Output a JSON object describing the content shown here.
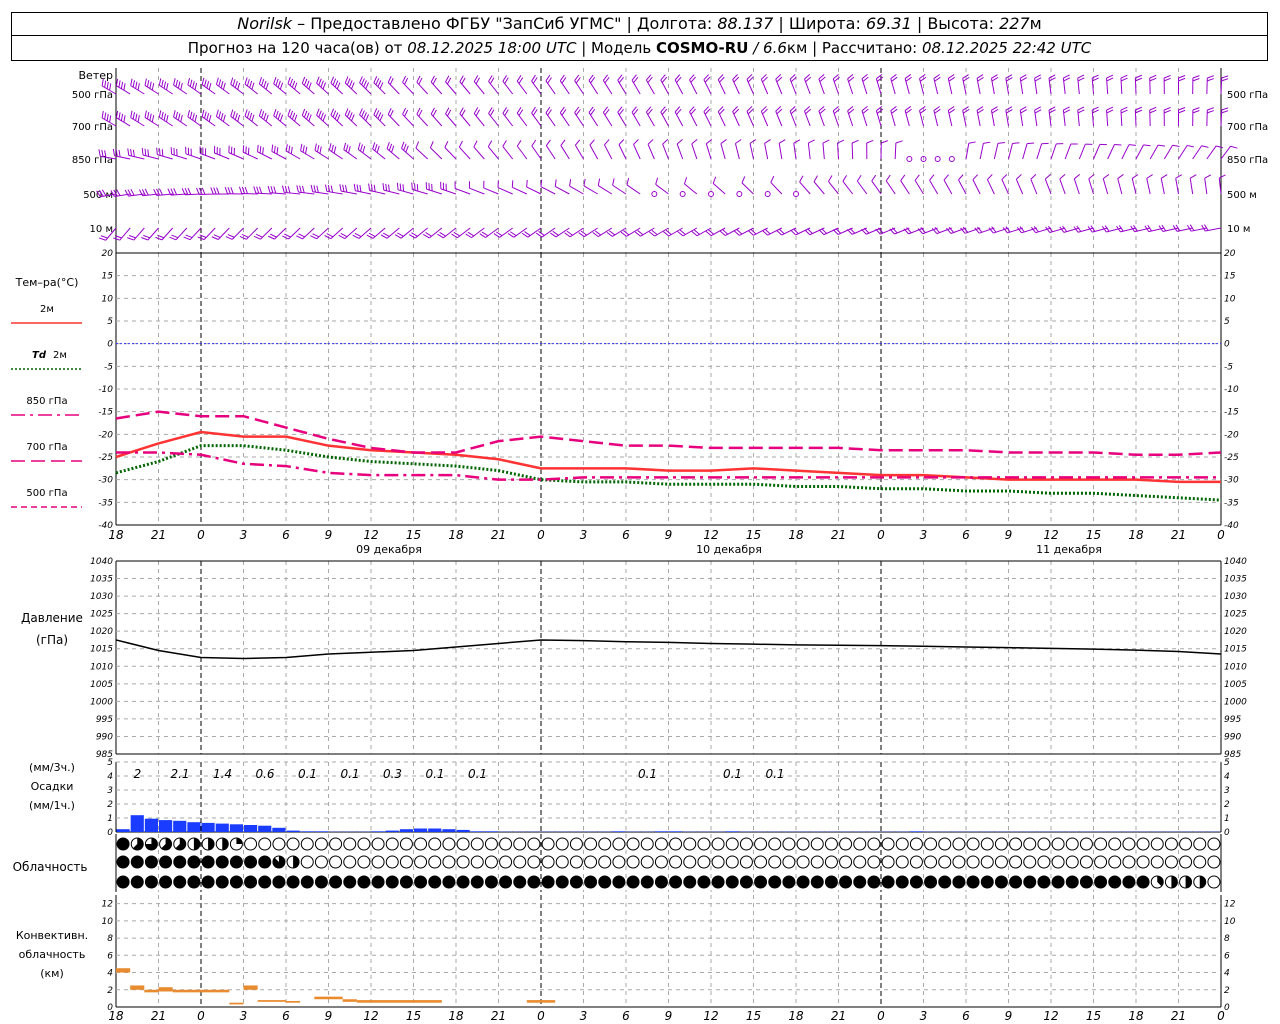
{
  "header": {
    "station": "Norilsk",
    "dash": " – ",
    "provider": "Предоставлено ФГБУ \"ЗапСиб УГМС\"",
    "sep": " | ",
    "lon_label": "Долгота: ",
    "lon_value": "88.137",
    "lat_label": "Широта: ",
    "lat_value": "69.31",
    "alt_label": "Высота: ",
    "alt_value": "227",
    "alt_unit": "м",
    "forecast_prefix": "Прогноз на 120 часа(ов) от ",
    "forecast_start": "08.12.2025 18:00 UTC",
    "model_label": "  | Модель ",
    "model_name": "COSMO-RU",
    "model_res": " / 6.6",
    "model_unit": "км",
    "computed_label": " | Рассчитано: ",
    "computed_time": "08.12.2025 22:42 UTC"
  },
  "colors": {
    "wind": "#9900cc",
    "t2m": "#ff3333",
    "td2m": "#006600",
    "t850": "#e6007e",
    "zero_line": "#3333ff",
    "pressure": "#000000",
    "precip": "#1a3cff",
    "conv": "#e88a2e",
    "grid": "#aaaaaa"
  },
  "wind_panel": {
    "title": "Ветер",
    "levels": [
      "500 гПа",
      "700 гПа",
      "850 гПа",
      "500  м",
      "10   м"
    ]
  },
  "temp_panel": {
    "title": "Тем–ра(°С)",
    "yticks": [
      20,
      15,
      10,
      5,
      0,
      -5,
      -10,
      -15,
      -20,
      -25,
      -30,
      -35,
      -40
    ],
    "legend": [
      {
        "label": "2м",
        "style": "solid",
        "color": "#ff3333"
      },
      {
        "label_a": "Td",
        "label_b": "2м",
        "style": "dotted",
        "color": "#006600"
      },
      {
        "label": "850 гПа",
        "style": "dash-dot",
        "color": "#e6007e"
      },
      {
        "label": "700 гПа",
        "style": "long-dash",
        "color": "#e6007e"
      },
      {
        "label": "500 гПа",
        "style": "short-dash",
        "color": "#e6007e"
      }
    ]
  },
  "x_axis": {
    "hour_labels": [
      "18",
      "21",
      "0",
      "3",
      "6",
      "9",
      "12",
      "15",
      "18",
      "21",
      "0",
      "3",
      "6",
      "9",
      "12",
      "15",
      "18",
      "21",
      "0",
      "3",
      "6",
      "9",
      "12",
      "15",
      "18",
      "21",
      "0"
    ],
    "dates": [
      "09 декабря",
      "10 декабря",
      "11 декабря"
    ]
  },
  "pressure_panel": {
    "title_a": "Давление",
    "title_b": "(гПа)",
    "yticks": [
      1040,
      1035,
      1030,
      1025,
      1020,
      1015,
      1010,
      1005,
      1000,
      995,
      990,
      985
    ]
  },
  "precip_panel": {
    "label_a": "(мм/3ч.)",
    "label_b": "Осадки",
    "label_c": "(мм/1ч.)",
    "yticks": [
      5,
      4,
      3,
      2,
      1,
      0
    ],
    "totals_3h": [
      {
        "h": 3,
        "v": "2"
      },
      {
        "h": 6,
        "v": "2.1"
      },
      {
        "h": 9,
        "v": "1.4"
      },
      {
        "h": 12,
        "v": "0.6"
      },
      {
        "h": 15,
        "v": "0.1"
      },
      {
        "h": 18,
        "v": "0.1"
      },
      {
        "h": 21,
        "v": "0.3"
      },
      {
        "h": 24,
        "v": "0.1"
      },
      {
        "h": 27,
        "v": "0.1"
      },
      {
        "h": 39,
        "v": "0.1"
      },
      {
        "h": 45,
        "v": "0.1"
      },
      {
        "h": 48,
        "v": "0.1"
      }
    ]
  },
  "cloud_panel": {
    "title": "Облачность"
  },
  "conv_panel": {
    "label_a": "Конвективн.",
    "label_b": "облачность",
    "label_c": "(км)",
    "yticks": [
      12,
      10,
      8,
      6,
      4,
      2,
      0
    ]
  },
  "chart_data": {
    "type": "line",
    "x_hours_from_start": [
      0,
      3,
      6,
      9,
      12,
      15,
      18,
      21,
      24,
      27,
      30,
      33,
      36,
      39,
      42,
      45,
      48,
      51,
      54,
      57,
      60,
      63,
      66,
      69,
      72,
      75,
      78
    ],
    "x_unit": "hours since 08.12.2025 18:00 UTC",
    "temperature": {
      "ylim": [
        -40,
        20
      ],
      "series": [
        {
          "name": "2м",
          "values": [
            -25,
            -22,
            -19.5,
            -20.5,
            -20.5,
            -22.5,
            -23.5,
            -24,
            -24.5,
            -25.5,
            -27.5,
            -27.5,
            -27.5,
            -28,
            -28,
            -27.5,
            -28,
            -28.5,
            -29,
            -29,
            -29.5,
            -30,
            -30,
            -30,
            -30,
            -30.5,
            -30.5
          ]
        },
        {
          "name": "Td 2м",
          "values": [
            -28.5,
            -26,
            -22.5,
            -22.5,
            -23.5,
            -25,
            -26,
            -26.5,
            -27,
            -28,
            -30,
            -30.5,
            -30.5,
            -31,
            -31,
            -31,
            -31.5,
            -31.5,
            -32,
            -32,
            -32.5,
            -32.5,
            -33,
            -33,
            -33.5,
            -34,
            -34.5
          ]
        },
        {
          "name": "850 гПа",
          "values": [
            -24,
            -24,
            -24.5,
            -26.5,
            -27,
            -28.5,
            -29,
            -29,
            -29,
            -30,
            -30,
            -29.5,
            -29.5,
            -29.5,
            -29.5,
            -29.5,
            -29.5,
            -29.5,
            -29.5,
            -29.5,
            -29.5,
            -29.5,
            -29.5,
            -29.5,
            -29.5,
            -29.5,
            -29.5
          ]
        },
        {
          "name": "700 гПа",
          "values": [
            -16.5,
            -15,
            -16,
            -16,
            -18.5,
            -21,
            -23,
            -24,
            -24,
            -21.5,
            -20.5,
            -21.5,
            -22.5,
            -22.5,
            -23,
            -23,
            -23,
            -23,
            -23.5,
            -23.5,
            -23.5,
            -24,
            -24,
            -24,
            -24.5,
            -24.5,
            -24
          ]
        }
      ]
    },
    "pressure": {
      "ylim": [
        985,
        1040
      ],
      "values": [
        1017.5,
        1014.5,
        1012.5,
        1012.2,
        1012.5,
        1013.5,
        1014,
        1014.5,
        1015.5,
        1016.5,
        1017.5,
        1017.3,
        1017,
        1016.8,
        1016.5,
        1016.3,
        1016.1,
        1016,
        1015.9,
        1015.7,
        1015.5,
        1015.3,
        1015.1,
        1014.9,
        1014.6,
        1014.2,
        1013.5
      ]
    },
    "precip_1h": {
      "ylim": [
        0,
        5
      ],
      "x": [
        1,
        2,
        3,
        4,
        5,
        6,
        7,
        8,
        9,
        10,
        11,
        12,
        13,
        14,
        15,
        16,
        17,
        18,
        19,
        20,
        21,
        22,
        23,
        24,
        25,
        26,
        27,
        28,
        29,
        30,
        31,
        32,
        33,
        34,
        35,
        36,
        37,
        38,
        39,
        40,
        41,
        42,
        43,
        44,
        45,
        46,
        47,
        48,
        49,
        50,
        51,
        52,
        53,
        54,
        55,
        56,
        57,
        58,
        59,
        60,
        61,
        62,
        63,
        64,
        65,
        66,
        67,
        68,
        69,
        70,
        71,
        72,
        73,
        74,
        75,
        76,
        77,
        78
      ],
      "values": [
        0.2,
        1.2,
        0.95,
        0.85,
        0.8,
        0.7,
        0.65,
        0.6,
        0.55,
        0.5,
        0.45,
        0.3,
        0.1,
        0.05,
        0.05,
        0.02,
        0.02,
        0.02,
        0.05,
        0.1,
        0.2,
        0.25,
        0.25,
        0.2,
        0.15,
        0.05,
        0.05,
        0.02,
        0.02,
        0.02,
        0.02,
        0.02,
        0.02,
        0.02,
        0.02,
        0.05,
        0.02,
        0.02,
        0.05,
        0.05,
        0.02,
        0.02,
        0.02,
        0.05,
        0.02,
        0.02,
        0.02,
        0.02,
        0.02,
        0.02,
        0.02,
        0.02,
        0.02,
        0.02,
        0.02,
        0.02,
        0.05,
        0.02,
        0.02,
        0.02,
        0.02,
        0.02,
        0.02,
        0.02,
        0.02,
        0.02,
        0.02,
        0.02,
        0.02,
        0.02,
        0.02,
        0.02,
        0.02,
        0.02,
        0.02,
        0.02,
        0.02,
        0.02
      ]
    },
    "cloud_cover_eighths": {
      "high": [
        8,
        5,
        6,
        5,
        5,
        4,
        4,
        4,
        2,
        0,
        0,
        0,
        0,
        0,
        0,
        0,
        0,
        0,
        0,
        0,
        0,
        0,
        0,
        0,
        0,
        0,
        0,
        0,
        0,
        0,
        0,
        0,
        0,
        0,
        0,
        0,
        0,
        0,
        0,
        0,
        0,
        0,
        0,
        0,
        0,
        0,
        0,
        0,
        0,
        0,
        0,
        0,
        0,
        0,
        0,
        0,
        0,
        0,
        0,
        0,
        0,
        0,
        0,
        0,
        0,
        0,
        0,
        0,
        0,
        0,
        0,
        0,
        0,
        0,
        0,
        0,
        0,
        0
      ],
      "mid": [
        8,
        8,
        8,
        8,
        8,
        8,
        8,
        8,
        8,
        8,
        8,
        7,
        4,
        0,
        0,
        0,
        0,
        0,
        0,
        0,
        0,
        0,
        0,
        0,
        0,
        0,
        0,
        0,
        0,
        0,
        0,
        0,
        0,
        0,
        0,
        0,
        0,
        0,
        0,
        0,
        0,
        0,
        0,
        0,
        0,
        0,
        0,
        0,
        0,
        0,
        0,
        0,
        0,
        0,
        0,
        0,
        0,
        0,
        0,
        0,
        0,
        0,
        0,
        0,
        0,
        0,
        0,
        0,
        0,
        0,
        0,
        0,
        0,
        0,
        0,
        0,
        0,
        0
      ],
      "low": [
        8,
        8,
        8,
        8,
        8,
        8,
        8,
        8,
        8,
        8,
        8,
        8,
        8,
        8,
        8,
        8,
        8,
        8,
        8,
        8,
        8,
        8,
        8,
        8,
        8,
        8,
        8,
        8,
        8,
        8,
        8,
        8,
        8,
        8,
        8,
        8,
        8,
        8,
        8,
        8,
        8,
        8,
        8,
        8,
        8,
        8,
        8,
        8,
        8,
        8,
        8,
        8,
        8,
        8,
        8,
        8,
        8,
        8,
        8,
        8,
        8,
        8,
        8,
        8,
        8,
        8,
        8,
        8,
        8,
        8,
        8,
        8,
        8,
        3,
        4,
        4,
        4,
        0
      ]
    },
    "convective_cloud_km": {
      "ylim": [
        0,
        13
      ],
      "segments": [
        {
          "h0": 0,
          "h1": 1,
          "top": 4.5,
          "bot": 4
        },
        {
          "h0": 1,
          "h1": 2,
          "top": 2.5,
          "bot": 2
        },
        {
          "h0": 2,
          "h1": 3,
          "top": 2,
          "bot": 1.7
        },
        {
          "h0": 3,
          "h1": 4,
          "top": 2.3,
          "bot": 1.8
        },
        {
          "h0": 4,
          "h1": 8,
          "top": 2,
          "bot": 1.7
        },
        {
          "h0": 8,
          "h1": 9,
          "top": 0.5,
          "bot": 0.3
        },
        {
          "h0": 9,
          "h1": 10,
          "top": 2.5,
          "bot": 2
        },
        {
          "h0": 10,
          "h1": 12,
          "top": 0.8,
          "bot": 0.6
        },
        {
          "h0": 12,
          "h1": 13,
          "top": 0.7,
          "bot": 0.5
        },
        {
          "h0": 14,
          "h1": 16,
          "top": 1.2,
          "bot": 0.9
        },
        {
          "h0": 16,
          "h1": 17,
          "top": 0.9,
          "bot": 0.6
        },
        {
          "h0": 17,
          "h1": 23,
          "top": 0.8,
          "bot": 0.5
        },
        {
          "h0": 29,
          "h1": 31,
          "top": 0.8,
          "bot": 0.5
        }
      ]
    }
  }
}
